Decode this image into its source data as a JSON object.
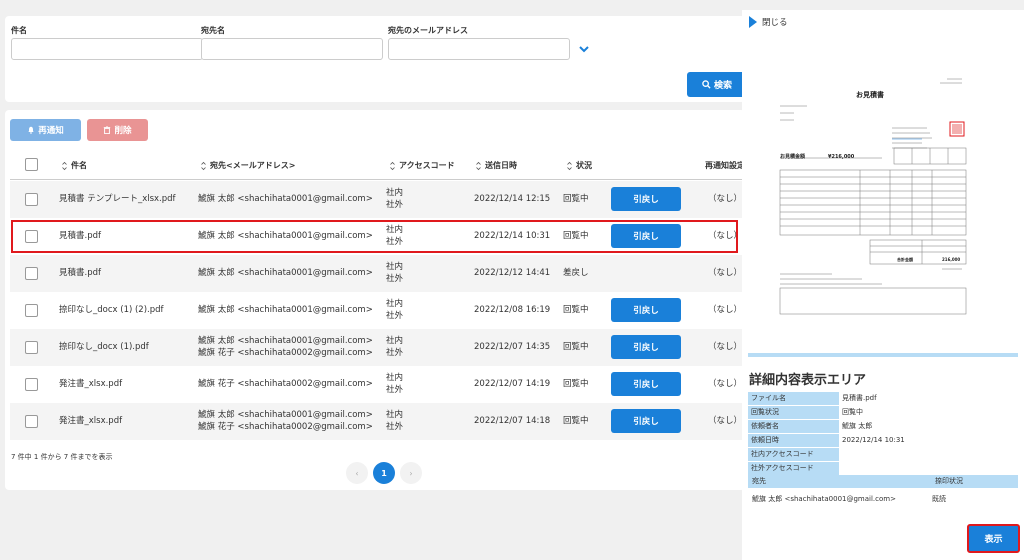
{
  "search": {
    "subject_label": "件名",
    "recipient_name_label": "宛先名",
    "recipient_email_label": "宛先のメールアドレス",
    "subject_value": "",
    "recipient_name_value": "",
    "recipient_email_value": "",
    "search_button": "検索"
  },
  "toolbar": {
    "renotify_label": "再通知",
    "delete_label": "削除"
  },
  "table": {
    "headers": {
      "subject": "件名",
      "recipient": "宛先<メールアドレス>",
      "access_code": "アクセスコード",
      "sent_at": "送信日時",
      "status": "状況",
      "renotify_setting": "再通知設定"
    },
    "rows": [
      {
        "subject": "見積書 テンプレート_xlsx.pdf",
        "recipient1": "鯱旗 太郎 <shachihata0001@gmail.com>",
        "recipient2": "",
        "code1": "社内",
        "code2": "社外",
        "sent_at": "2022/12/14 12:15",
        "status": "回覧中",
        "action": "引戻し",
        "renotify": "（なし）"
      },
      {
        "subject": "見積書.pdf",
        "recipient1": "鯱旗 太郎 <shachihata0001@gmail.com>",
        "recipient2": "",
        "code1": "社内",
        "code2": "社外",
        "sent_at": "2022/12/14 10:31",
        "status": "回覧中",
        "action": "引戻し",
        "renotify": "（なし）"
      },
      {
        "subject": "見積書.pdf",
        "recipient1": "鯱旗 太郎 <shachihata0001@gmail.com>",
        "recipient2": "",
        "code1": "社内",
        "code2": "社外",
        "sent_at": "2022/12/12 14:41",
        "status": "差戻し",
        "action": "",
        "renotify": "（なし）"
      },
      {
        "subject": "捺印なし_docx (1) (2).pdf",
        "recipient1": "鯱旗 太郎 <shachihata0001@gmail.com>",
        "recipient2": "",
        "code1": "社内",
        "code2": "社外",
        "sent_at": "2022/12/08 16:19",
        "status": "回覧中",
        "action": "引戻し",
        "renotify": "（なし）"
      },
      {
        "subject": "捺印なし_docx (1).pdf",
        "recipient1": "鯱旗 太郎 <shachihata0001@gmail.com>",
        "recipient2": "鯱旗 花子 <shachihata0002@gmail.com>",
        "code1": "社内",
        "code2": "社外",
        "sent_at": "2022/12/07 14:35",
        "status": "回覧中",
        "action": "引戻し",
        "renotify": "（なし）"
      },
      {
        "subject": "発注書_xlsx.pdf",
        "recipient1": "鯱旗 花子 <shachihata0002@gmail.com>",
        "recipient2": "",
        "code1": "社内",
        "code2": "社外",
        "sent_at": "2022/12/07 14:19",
        "status": "回覧中",
        "action": "引戻し",
        "renotify": "（なし）"
      },
      {
        "subject": "発注書_xlsx.pdf",
        "recipient1": "鯱旗 太郎 <shachihata0001@gmail.com>",
        "recipient2": "鯱旗 花子 <shachihata0002@gmail.com>",
        "code1": "社内",
        "code2": "社外",
        "sent_at": "2022/12/07 14:18",
        "status": "回覧中",
        "action": "引戻し",
        "renotify": "（なし）"
      }
    ]
  },
  "pagination": {
    "summary": "7 件中 1 件から 7 件までを表示",
    "prev": "‹",
    "current": "1",
    "next": "›"
  },
  "detail": {
    "close_label": "閉じる",
    "title": "詳細内容表示エリア",
    "fields": [
      {
        "label": "ファイル名",
        "value": "見積書.pdf"
      },
      {
        "label": "回覧状況",
        "value": "回覧中"
      },
      {
        "label": "依頼者名",
        "value": "鯱旗 太郎"
      },
      {
        "label": "依頼日時",
        "value": "2022/12/14 10:31"
      },
      {
        "label": "社内アクセスコード",
        "value": ""
      },
      {
        "label": "社外アクセスコード",
        "value": ""
      }
    ],
    "recipients_header": "宛先",
    "read_status_header": "捺印状況",
    "recipients": [
      {
        "name": "鯱旗 太郎 <shachihata0001@gmail.com>",
        "status": "既読"
      }
    ],
    "show_button": "表示",
    "preview": {
      "title": "お見積書",
      "amount_label": "お見積金額",
      "amount_value": "¥216,000",
      "total_label": "合計金額",
      "total_value": "216,000"
    }
  },
  "colors": {
    "primary": "#1a80d9",
    "renotify_disabled": "#7fb2e5",
    "delete_disabled": "#e99494",
    "highlight": "#e0191d",
    "label_bg": "#b7dcf5"
  }
}
